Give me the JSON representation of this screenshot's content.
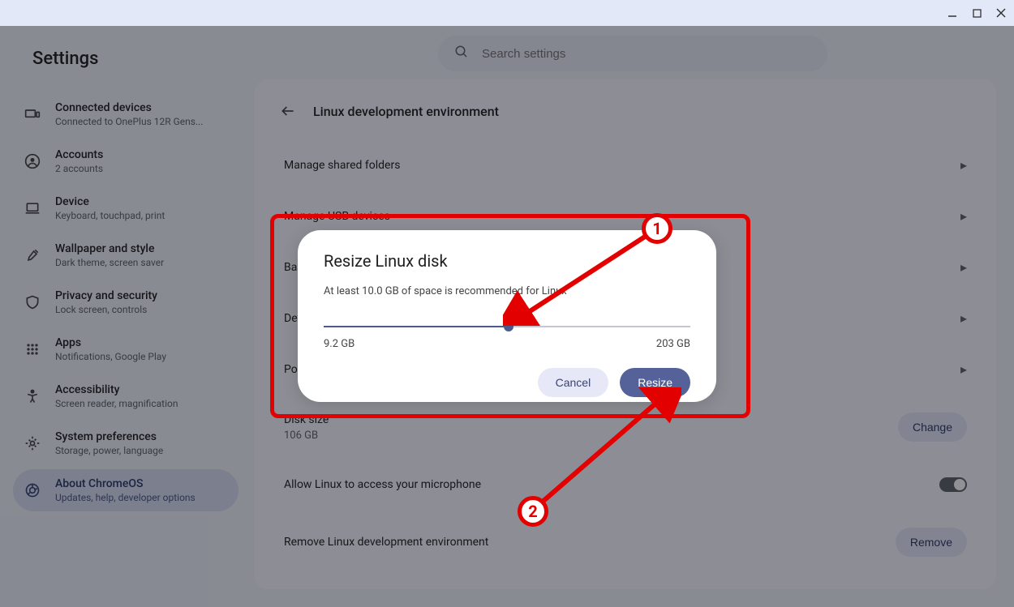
{
  "window": {
    "minimize": "–",
    "maximize": "□",
    "close": "×"
  },
  "app_title": "Settings",
  "search": {
    "placeholder": "Search settings"
  },
  "sidebar": {
    "items": [
      {
        "label": "Connected devices",
        "sub": "Connected to OnePlus 12R Gens..."
      },
      {
        "label": "Accounts",
        "sub": "2 accounts"
      },
      {
        "label": "Device",
        "sub": "Keyboard, touchpad, print"
      },
      {
        "label": "Wallpaper and style",
        "sub": "Dark theme, screen saver"
      },
      {
        "label": "Privacy and security",
        "sub": "Lock screen, controls"
      },
      {
        "label": "Apps",
        "sub": "Notifications, Google Play"
      },
      {
        "label": "Accessibility",
        "sub": "Screen reader, magnification"
      },
      {
        "label": "System preferences",
        "sub": "Storage, power, language"
      },
      {
        "label": "About ChromeOS",
        "sub": "Updates, help, developer options"
      }
    ]
  },
  "page": {
    "title": "Linux development environment",
    "rows": {
      "shared": "Manage shared folders",
      "usb": "Manage USB devices",
      "backup": "Back",
      "develop": "Dev",
      "port": "Port",
      "disk_label": "Disk size",
      "disk_value": "106 GB",
      "change": "Change",
      "mic": "Allow Linux to access your microphone",
      "remove_label": "Remove Linux development environment",
      "remove_btn": "Remove"
    }
  },
  "dialog": {
    "title": "Resize Linux disk",
    "text": "At least 10.0 GB of space is recommended for Linux",
    "min": "9.2 GB",
    "max": "203 GB",
    "cancel": "Cancel",
    "confirm": "Resize"
  },
  "annotations": {
    "c1": "1",
    "c2": "2"
  }
}
